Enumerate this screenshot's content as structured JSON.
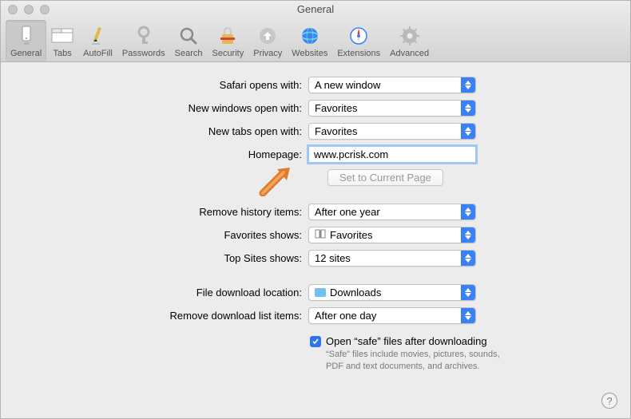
{
  "window": {
    "title": "General"
  },
  "toolbar": {
    "items": [
      {
        "label": "General"
      },
      {
        "label": "Tabs"
      },
      {
        "label": "AutoFill"
      },
      {
        "label": "Passwords"
      },
      {
        "label": "Search"
      },
      {
        "label": "Security"
      },
      {
        "label": "Privacy"
      },
      {
        "label": "Websites"
      },
      {
        "label": "Extensions"
      },
      {
        "label": "Advanced"
      }
    ]
  },
  "labels": {
    "safari_opens": "Safari opens with:",
    "new_windows": "New windows open with:",
    "new_tabs": "New tabs open with:",
    "homepage": "Homepage:",
    "set_current": "Set to Current Page",
    "remove_history": "Remove history items:",
    "favorites_shows": "Favorites shows:",
    "top_sites": "Top Sites shows:",
    "download_loc": "File download location:",
    "remove_download": "Remove download list items:",
    "open_safe": "Open “safe” files after downloading",
    "open_safe_desc": "“Safe” files include movies, pictures, sounds, PDF and text documents, and archives.",
    "help": "?"
  },
  "values": {
    "safari_opens": "A new window",
    "new_windows": "Favorites",
    "new_tabs": "Favorites",
    "homepage": "www.pcrisk.com",
    "remove_history": "After one year",
    "favorites_shows": "Favorites",
    "top_sites": "12 sites",
    "download_loc": "Downloads",
    "remove_download": "After one day"
  }
}
